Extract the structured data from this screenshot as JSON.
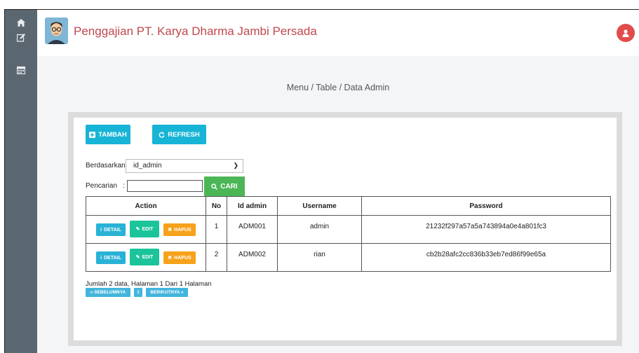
{
  "header": {
    "title": "Penggajian PT. Karya Dharma Jambi Persada"
  },
  "sidebar": {
    "icons": [
      "home-icon",
      "edit-icon",
      "calendar-icon"
    ]
  },
  "breadcrumb": "Menu / Table / Data Admin",
  "toolbar": {
    "add_label": "TAMBAH",
    "refresh_label": "REFRESH"
  },
  "filter": {
    "by_label": "Berdasarkan:",
    "by_value": "id_admin",
    "search_label": "Pencarian",
    "search_colon": ":",
    "search_value": "",
    "search_button": "CARI"
  },
  "table": {
    "headers": [
      "Action",
      "No",
      "Id admin",
      "Username",
      "Password"
    ],
    "action_labels": {
      "detail": "DETAIL",
      "edit": "EDIT",
      "delete": "HAPUS"
    },
    "rows": [
      {
        "no": "1",
        "id_admin": "ADM001",
        "username": "admin",
        "password": "21232f297a57a5a743894a0e4a801fc3"
      },
      {
        "no": "2",
        "id_admin": "ADM002",
        "username": "rian",
        "password": "cb2b28afc2cc836b33eb7ed86f99e65a"
      }
    ]
  },
  "pagination": {
    "summary": "Jumlah 2 data, Halaman 1 Dari 1 Halaman",
    "prev": "« SEBELUMNYA",
    "current": "1",
    "next": "BERIKUTNYA »"
  },
  "colors": {
    "sidebar": "#5b6770",
    "title": "#c0474d",
    "teal": "#17b4d6",
    "green": "#4cb656",
    "edit": "#1bc49a",
    "hapus": "#f6a21a",
    "user": "#e24b4b"
  }
}
